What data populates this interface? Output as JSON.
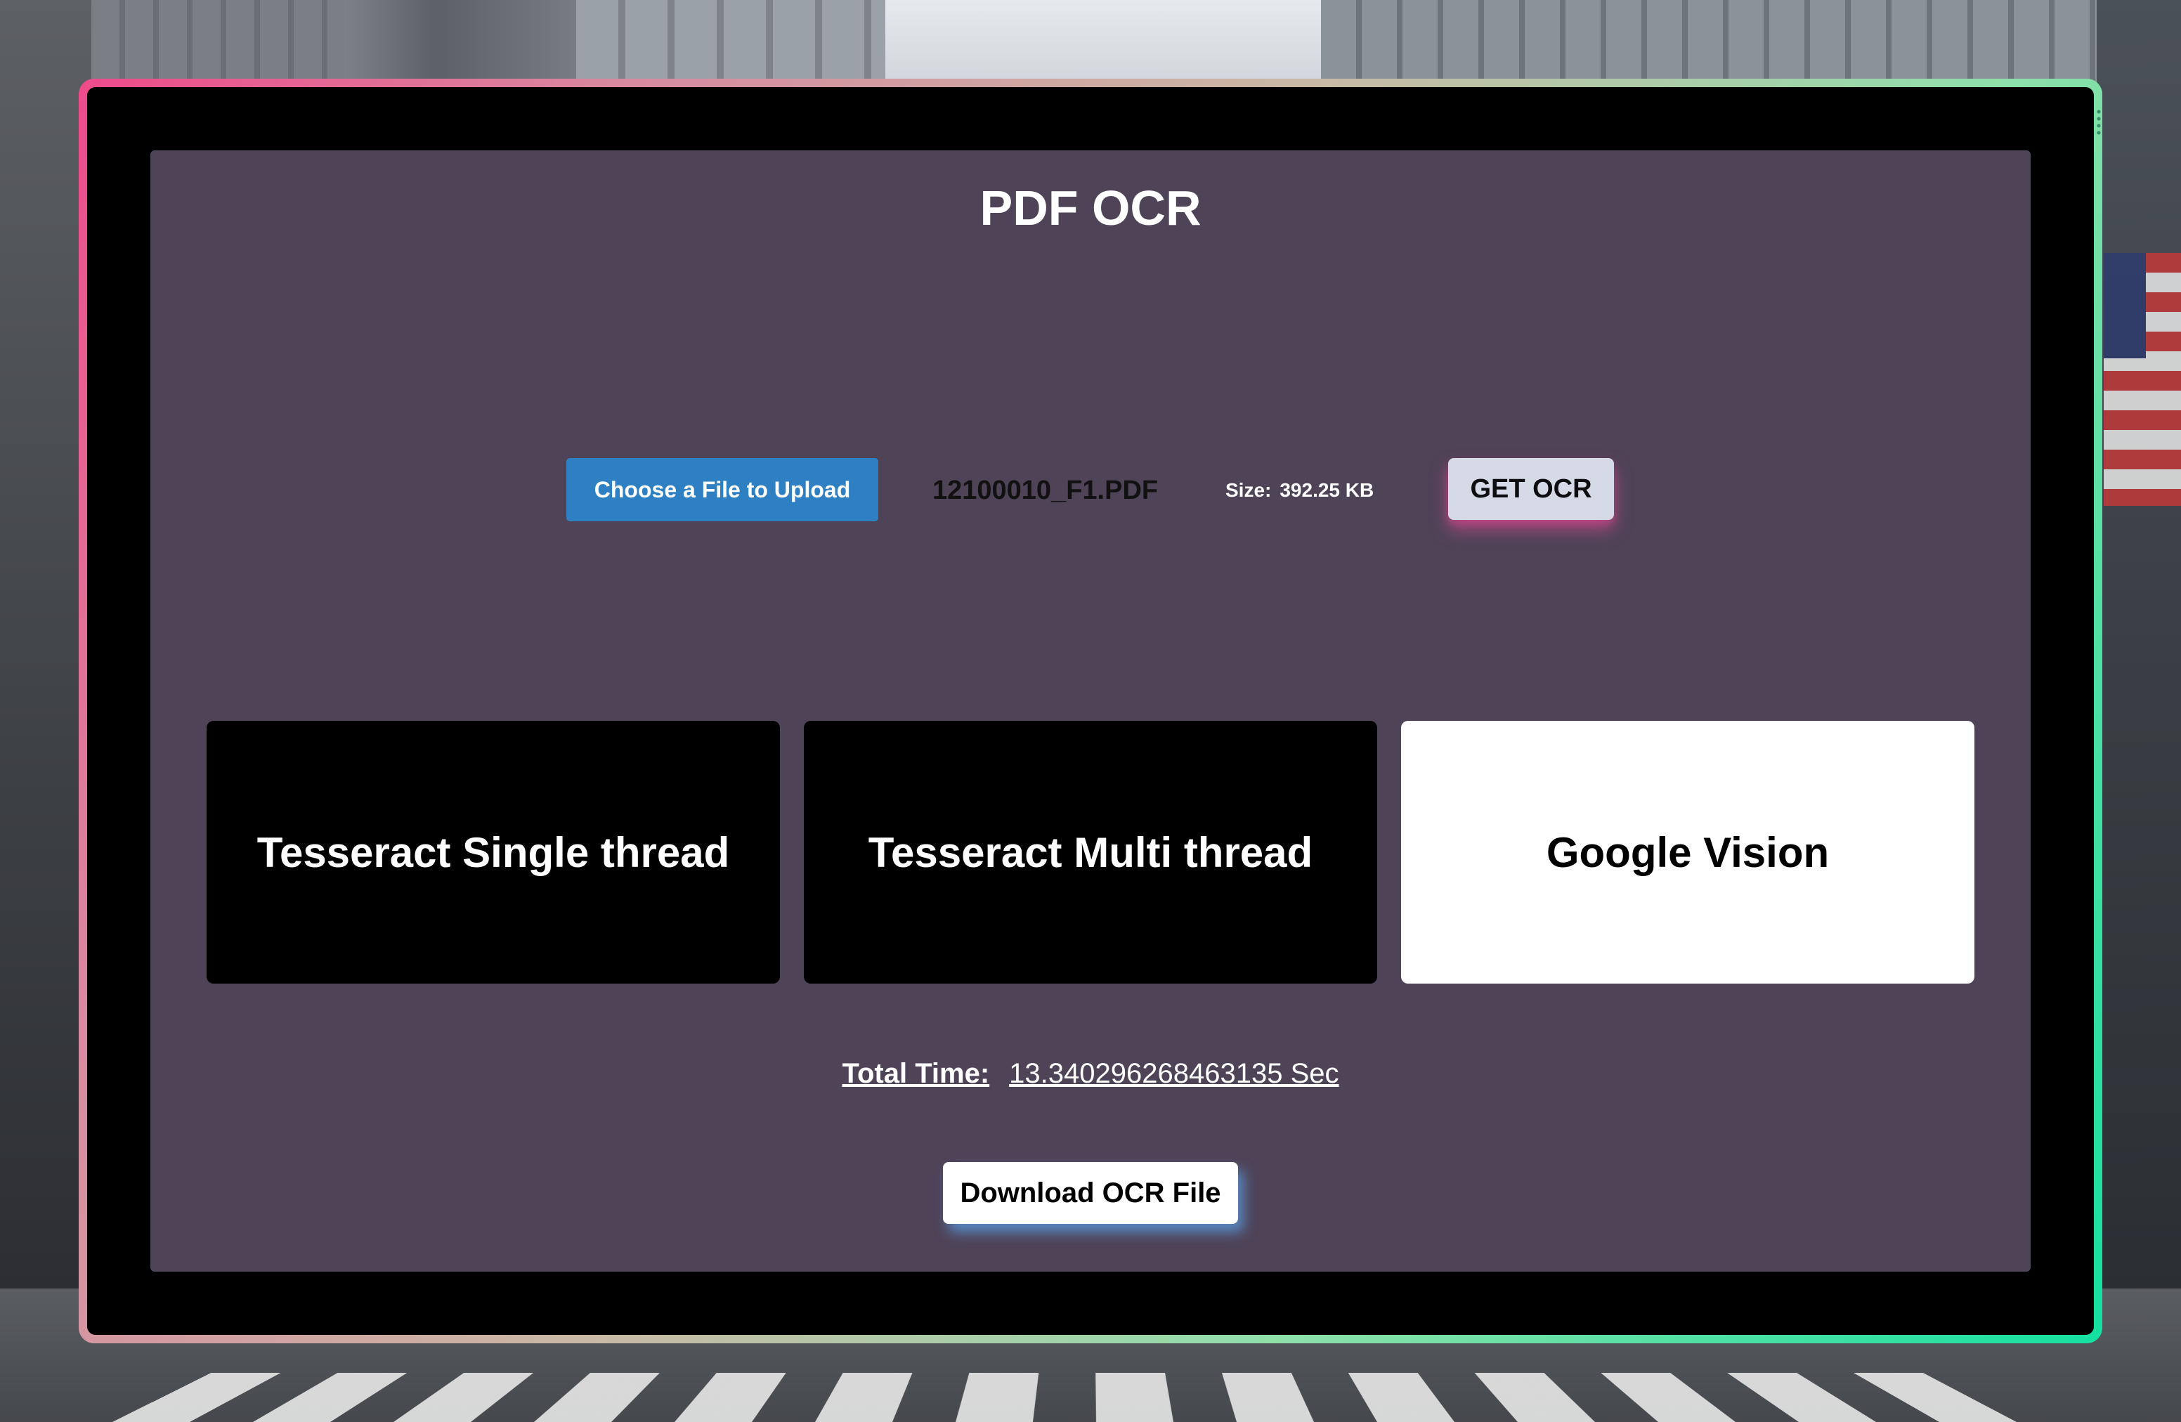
{
  "app": {
    "title": "PDF OCR"
  },
  "upload": {
    "choose_label": "Choose a File to Upload",
    "file_name": "12100010_F1.PDF",
    "size_label": "Size:",
    "size_value": "392.25 KB",
    "get_ocr_label": "GET OCR"
  },
  "engines": [
    {
      "label": "Tesseract Single thread",
      "selected": false
    },
    {
      "label": "Tesseract Multi thread",
      "selected": false
    },
    {
      "label": "Google Vision",
      "selected": true
    }
  ],
  "result": {
    "total_time_label": "Total Time:",
    "total_time_value": "13.340296268463135 Sec",
    "download_label": "Download OCR File"
  },
  "colors": {
    "panel_bg": "#4f4358",
    "choose_button": "#2f80c2",
    "get_ocr_button": "#d6d9e6",
    "frame_gradient_start": "#ee4a8a",
    "frame_gradient_end": "#14e0a0"
  }
}
